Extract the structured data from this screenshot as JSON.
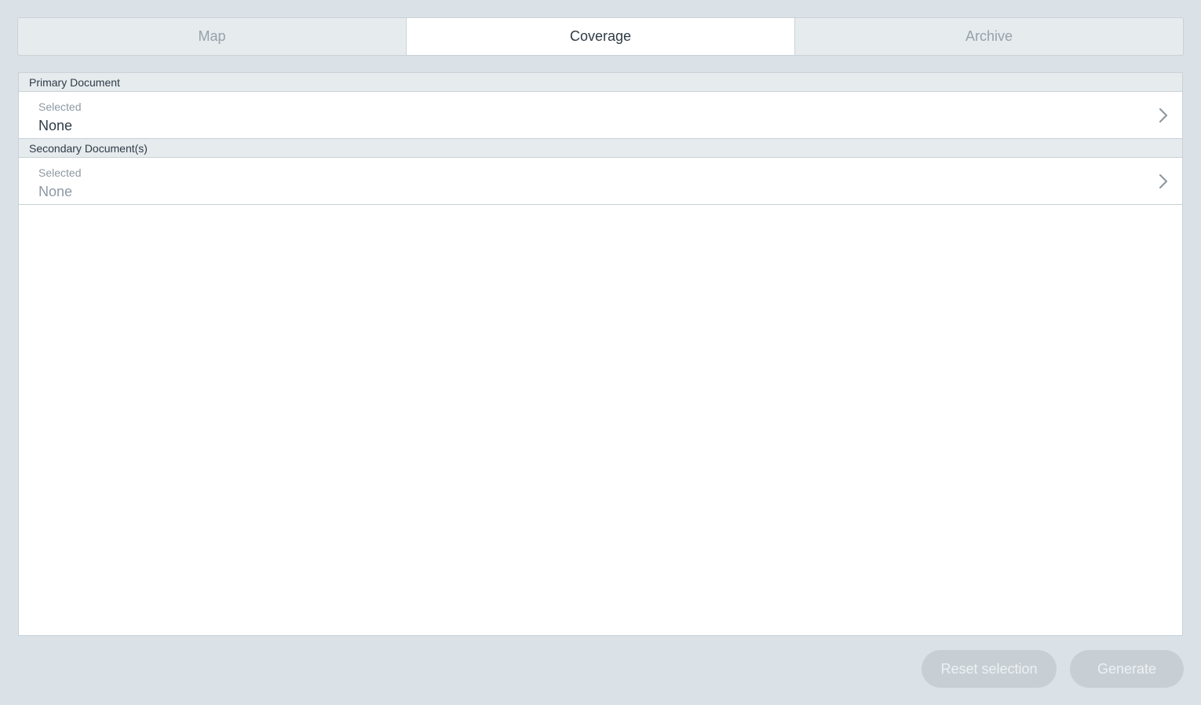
{
  "tabs": [
    {
      "label": "Map",
      "active": false
    },
    {
      "label": "Coverage",
      "active": true
    },
    {
      "label": "Archive",
      "active": false
    }
  ],
  "primary": {
    "header": "Primary Document",
    "selected_label": "Selected",
    "selected_value": "None"
  },
  "secondary": {
    "header": "Secondary Document(s)",
    "selected_label": "Selected",
    "selected_value": "None"
  },
  "footer": {
    "reset_label": "Reset selection",
    "generate_label": "Generate"
  },
  "icons": {
    "row_chevron": "chevron-right-icon"
  },
  "colors": {
    "background": "#dbe2e7",
    "panel": "#ffffff",
    "header_bg": "#e6ebee",
    "disabled_button": "#c7cfd5"
  }
}
